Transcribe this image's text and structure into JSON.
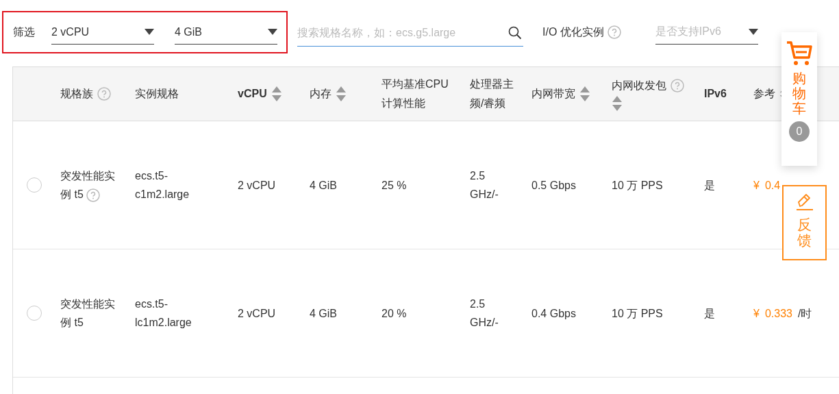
{
  "filters": {
    "label": "筛选",
    "highlighted": true,
    "dropdowns": [
      {
        "value": "2 vCPU"
      },
      {
        "value": "4 GiB"
      }
    ],
    "search": {
      "placeholder": "搜索规格名称，如：ecs.g5.large",
      "focused": true
    },
    "io_label": "I/O 优化实例",
    "ipv6_dropdown": {
      "placeholder": "是否支持IPv6"
    }
  },
  "table": {
    "columns": [
      {
        "label": "规格族",
        "help": true,
        "sortable": false,
        "bold": false
      },
      {
        "label": "实例规格",
        "help": false,
        "sortable": false,
        "bold": false
      },
      {
        "label": "vCPU",
        "help": false,
        "sortable": true,
        "bold": true
      },
      {
        "label": "内存",
        "help": false,
        "sortable": true,
        "bold": false
      },
      {
        "label": "平均基准CPU计算性能",
        "help": false,
        "sortable": false,
        "bold": false
      },
      {
        "label": "处理器主频/睿频",
        "help": false,
        "sortable": false,
        "bold": false
      },
      {
        "label": "内网带宽",
        "help": false,
        "sortable": true,
        "bold": false
      },
      {
        "label": "内网收发包",
        "help": true,
        "sortable": true,
        "bold": false
      },
      {
        "label": "IPv6",
        "help": false,
        "sortable": false,
        "bold": true
      },
      {
        "label": "参考",
        "help": false,
        "sortable": true,
        "bold": false
      }
    ],
    "rows": [
      {
        "selected": false,
        "family": "突发性能实例 t5",
        "family_help": true,
        "spec": "ecs.t5-c1m2.large",
        "vcpu": "2 vCPU",
        "memory": "4 GiB",
        "cpu_perf": "25 %",
        "frequency": "2.5 GHz/-",
        "bandwidth": "0.5 Gbps",
        "pps": "10 万 PPS",
        "ipv6": "是",
        "price": {
          "currency": "¥",
          "amount": "0.4"
        }
      },
      {
        "selected": false,
        "family": "突发性能实例 t5",
        "family_help": false,
        "spec": "ecs.t5-lc1m2.large",
        "vcpu": "2 vCPU",
        "memory": "4 GiB",
        "cpu_perf": "20 %",
        "frequency": "2.5 GHz/-",
        "bandwidth": "0.4 Gbps",
        "pps": "10 万 PPS",
        "ipv6": "是",
        "price": {
          "currency": "¥",
          "amount": "0.333",
          "unit": "/时"
        }
      }
    ]
  },
  "cart": {
    "label": "购物车",
    "count": "0"
  },
  "feedback": {
    "label": "反馈"
  }
}
